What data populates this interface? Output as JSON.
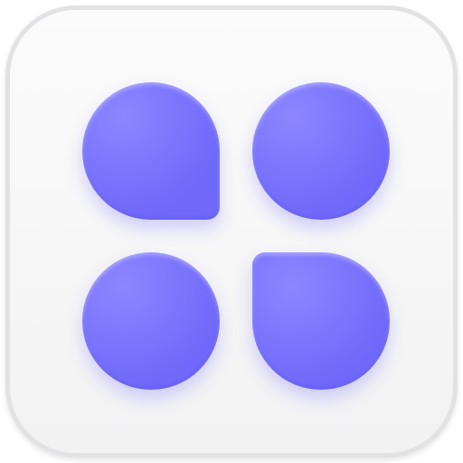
{
  "icon": {
    "shape_light": "#8d86ff",
    "shape_dark": "#6f68fa",
    "tiles": [
      {
        "shape": "rounded-bottom-right-corner-square"
      },
      {
        "shape": "circle"
      },
      {
        "shape": "circle"
      },
      {
        "shape": "rounded-top-left-corner-square"
      }
    ]
  }
}
